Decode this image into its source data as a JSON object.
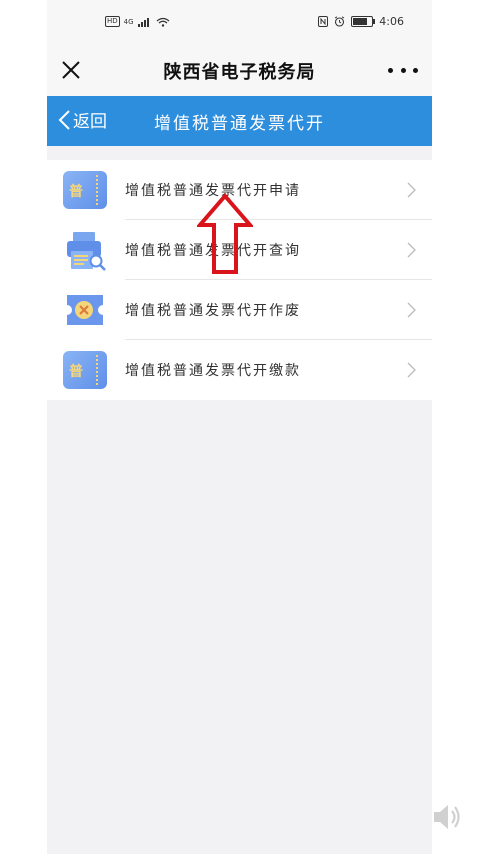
{
  "status_bar": {
    "badge": "HD",
    "network": "4G",
    "time": "4:06"
  },
  "header": {
    "title": "陕西省电子税务局"
  },
  "navbar": {
    "back_label": "返回",
    "title": "增值税普通发票代开"
  },
  "menu": {
    "items": [
      {
        "label": "增值税普通发票代开申请",
        "icon": "invoice-ticket-icon",
        "glyph": "普"
      },
      {
        "label": "增值税普通发票代开查询",
        "icon": "printer-search-icon"
      },
      {
        "label": "增值税普通发票代开作废",
        "icon": "cancel-ticket-icon"
      },
      {
        "label": "增值税普通发票代开缴款",
        "icon": "payment-ticket-icon",
        "glyph": "普"
      }
    ]
  },
  "colors": {
    "nav_blue": "#2d8ede",
    "icon_blue": "#6a97ec",
    "icon_gold": "#f4d67a",
    "annotation_red": "#d9141b"
  }
}
